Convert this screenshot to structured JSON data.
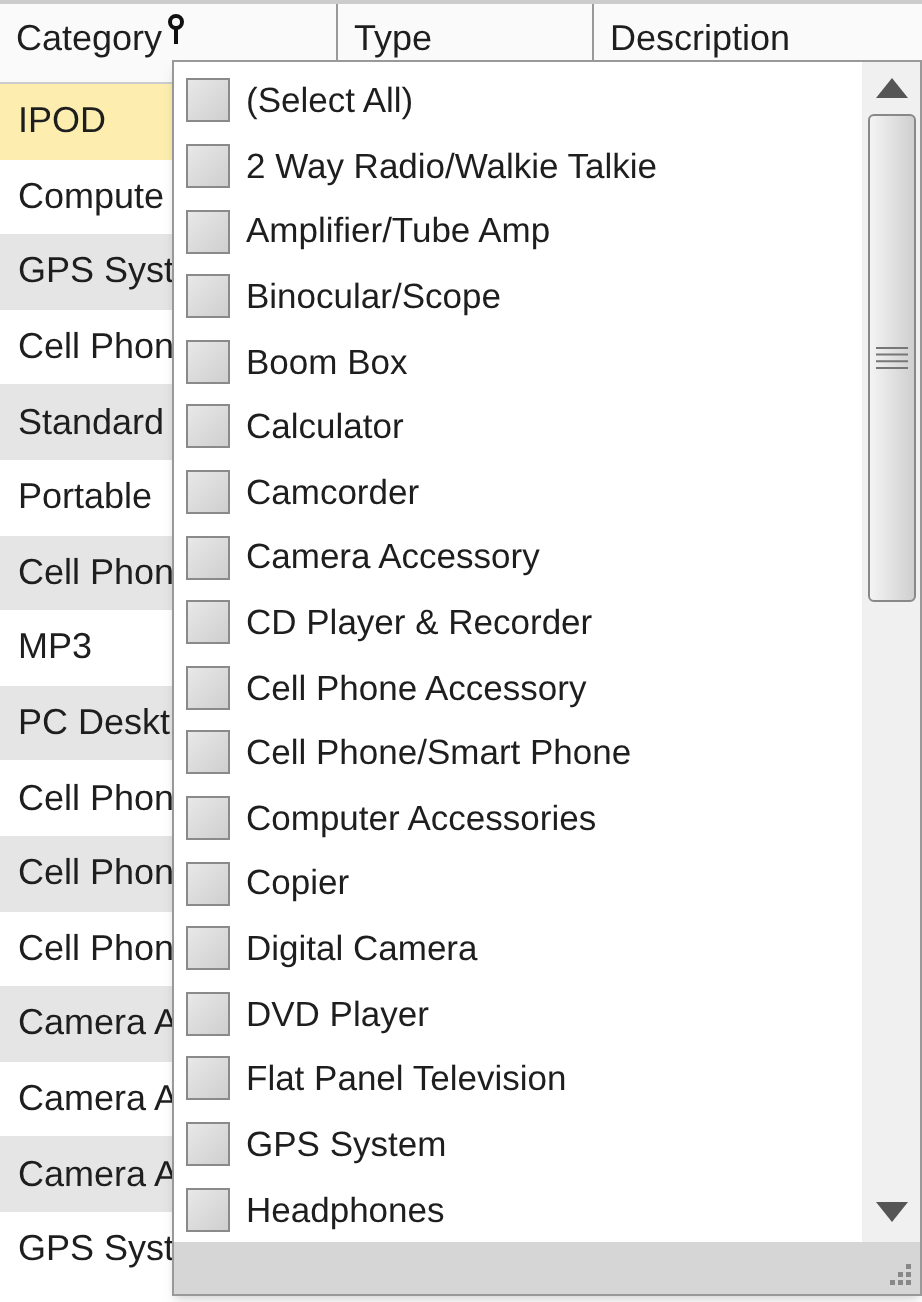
{
  "columns": [
    {
      "label": "Category",
      "filter": true
    },
    {
      "label": "Type",
      "filter": false
    },
    {
      "label": "Description",
      "filter": false
    }
  ],
  "rows": [
    {
      "category": "IPOD",
      "selected": true
    },
    {
      "category": "Compute",
      "selected": false
    },
    {
      "category": "GPS Syst",
      "selected": false
    },
    {
      "category": "Cell Phon",
      "selected": false
    },
    {
      "category": "Standard",
      "selected": false
    },
    {
      "category": "Portable",
      "selected": false
    },
    {
      "category": "Cell Phon",
      "selected": false
    },
    {
      "category": "MP3",
      "selected": false
    },
    {
      "category": "PC Deskt",
      "selected": false
    },
    {
      "category": "Cell Phon",
      "selected": false
    },
    {
      "category": "Cell Phon",
      "selected": false
    },
    {
      "category": "Cell Phon",
      "selected": false
    },
    {
      "category": "Camera A",
      "selected": false
    },
    {
      "category": "Camera A",
      "selected": false
    },
    {
      "category": "Camera A",
      "selected": false
    },
    {
      "category": "GPS Syst",
      "selected": false
    }
  ],
  "filter_popup": {
    "items": [
      {
        "label": "(Select All)",
        "checked": false
      },
      {
        "label": "2 Way Radio/Walkie Talkie",
        "checked": false
      },
      {
        "label": "Amplifier/Tube Amp",
        "checked": false
      },
      {
        "label": "Binocular/Scope",
        "checked": false
      },
      {
        "label": "Boom Box",
        "checked": false
      },
      {
        "label": "Calculator",
        "checked": false
      },
      {
        "label": "Camcorder",
        "checked": false
      },
      {
        "label": "Camera Accessory",
        "checked": false
      },
      {
        "label": "CD Player & Recorder",
        "checked": false
      },
      {
        "label": "Cell Phone Accessory",
        "checked": false
      },
      {
        "label": "Cell Phone/Smart Phone",
        "checked": false
      },
      {
        "label": "Computer Accessories",
        "checked": false
      },
      {
        "label": "Copier",
        "checked": false
      },
      {
        "label": "Digital Camera",
        "checked": false
      },
      {
        "label": "DVD Player",
        "checked": false
      },
      {
        "label": "Flat Panel Television",
        "checked": false
      },
      {
        "label": "GPS System",
        "checked": false
      },
      {
        "label": "Headphones",
        "checked": false
      }
    ]
  }
}
